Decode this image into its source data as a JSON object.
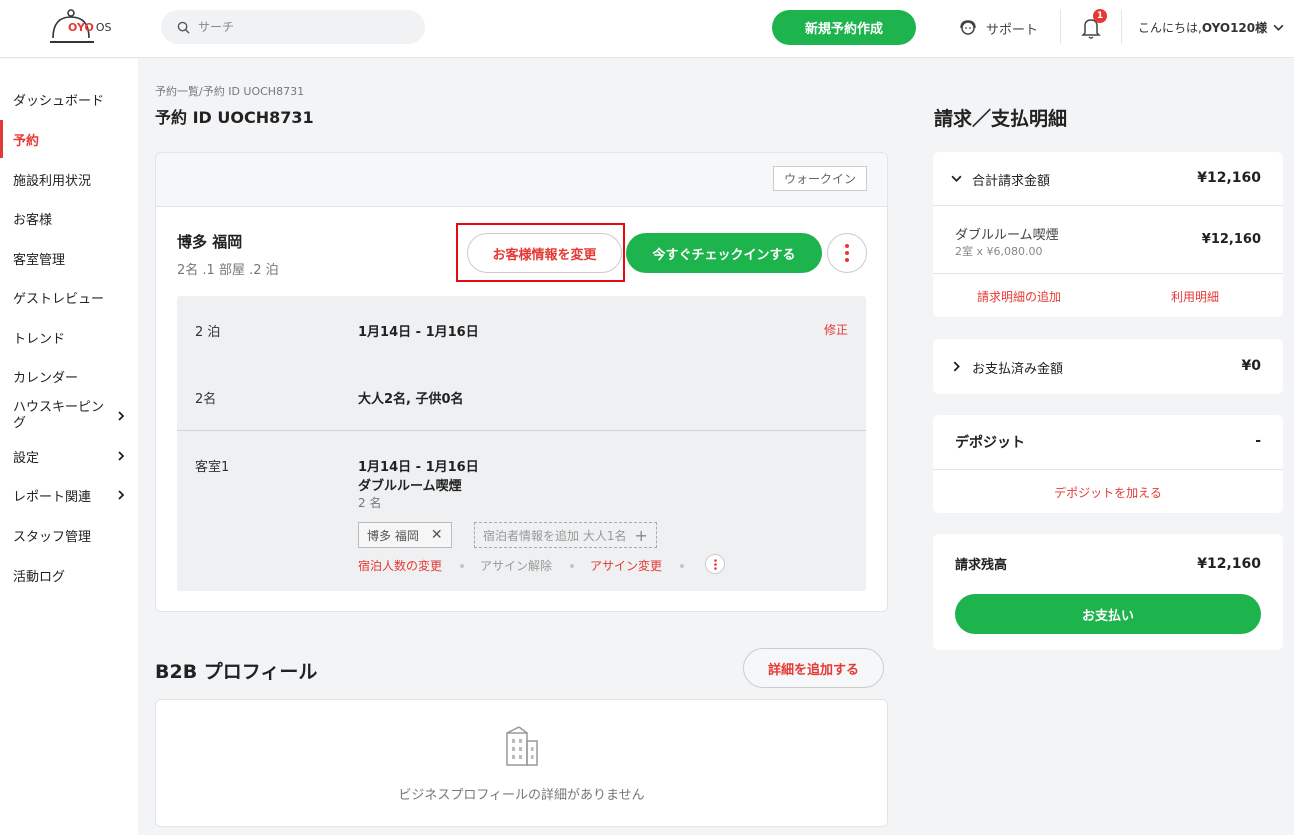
{
  "header": {
    "logo_text": "OYO",
    "logo_suffix": "OS",
    "search_placeholder": "サーチ",
    "new_booking_label": "新規予約作成",
    "support_label": "サポート",
    "notification_count": "1",
    "greeting_prefix": "こんにちは, ",
    "greeting_user": "OYO120様"
  },
  "sidebar": {
    "items": [
      {
        "label": "ダッシュボード"
      },
      {
        "label": "予約"
      },
      {
        "label": "施設利用状況"
      },
      {
        "label": "お客様"
      },
      {
        "label": "客室管理"
      },
      {
        "label": "ゲストレビュー"
      },
      {
        "label": "トレンド"
      },
      {
        "label": "カレンダー"
      },
      {
        "label": "ハウスキーピング"
      },
      {
        "label": "設定"
      },
      {
        "label": "レポート関連"
      },
      {
        "label": "スタッフ管理"
      },
      {
        "label": "活動ログ"
      }
    ]
  },
  "page": {
    "breadcrumb": "予約一覧/予約 ID UOCH8731",
    "title": "予約 ID UOCH8731"
  },
  "booking": {
    "source_badge": "ウォークイン",
    "guest_name": "博多 福岡",
    "summary": "2名 .1 部屋 .2 泊",
    "edit_guest_label": "お客様情報を変更",
    "checkin_label": "今すぐチェックインする",
    "nights_label": "2 泊",
    "dates": "1月14日 - 1月16日",
    "edit_link": "修正",
    "guests_label": "2名",
    "guests_detail": "大人2名, 子供0名",
    "room_label": "客室1",
    "room_dates": "1月14日 - 1月16日",
    "room_type": "ダブルルーム喫煙",
    "room_guests": "2 名",
    "chip_guest": "博多 福岡",
    "chip_add": "宿泊者情報を追加 大人1名",
    "action_change_guests": "宿泊人数の変更",
    "action_unassign": "アサイン解除",
    "action_reassign": "アサイン変更"
  },
  "b2b": {
    "title": "B2B プロフィール",
    "add_detail_label": "詳細を追加する",
    "empty_text": "ビジネスプロフィールの詳細がありません"
  },
  "billing": {
    "title": "請求／支払明細",
    "total_label": "合計請求金額",
    "total_amount": "¥12,160",
    "line_item_name": "ダブルルーム喫煙",
    "line_item_detail": "2室 x ¥6,080.00",
    "line_item_amount": "¥12,160",
    "add_charge_link": "請求明細の追加",
    "usage_link": "利用明細",
    "paid_label": "お支払済み金額",
    "paid_amount": "¥0",
    "deposit_label": "デポジット",
    "deposit_amount": "-",
    "add_deposit_link": "デポジットを加える",
    "balance_label": "請求残高",
    "balance_amount": "¥12,160",
    "pay_label": "お支払い"
  },
  "colors": {
    "brand_red": "#e53935",
    "accent_green": "#1db34d",
    "highlight_box": "#e50914"
  },
  "icons": [
    "search-icon",
    "support-headset-icon",
    "bell-icon",
    "chevron-down-icon",
    "chevron-right-icon",
    "more-vertical-icon",
    "close-icon",
    "plus-icon",
    "building-icon"
  ]
}
